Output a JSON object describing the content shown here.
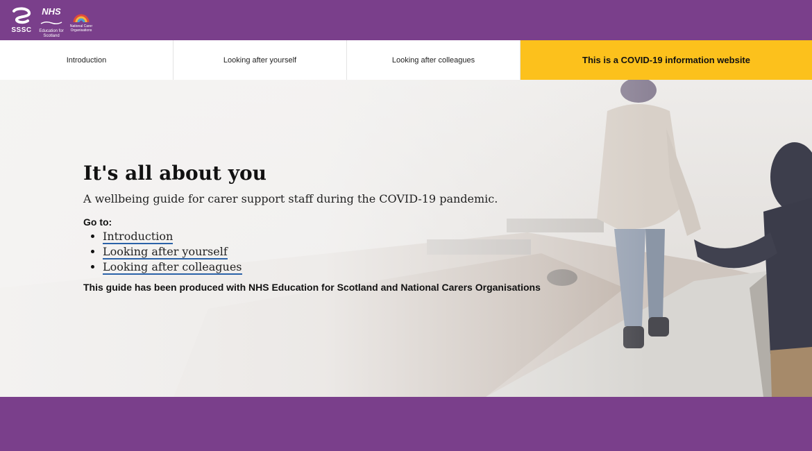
{
  "header": {
    "logos": {
      "sssc": "SSSC",
      "nhs": "NHS",
      "nhs_sub": "Education for Scotland",
      "nco_sub": "National Carer Organisations"
    }
  },
  "nav": {
    "items": [
      {
        "label": "Introduction"
      },
      {
        "label": "Looking after yourself"
      },
      {
        "label": "Looking after colleagues"
      }
    ],
    "covid_banner": "This is a COVID-19 information website"
  },
  "hero": {
    "title": "It's all about you",
    "subtitle": "A wellbeing guide for carer support staff during the COVID-19 pandemic.",
    "goto_label": "Go to:",
    "links": [
      {
        "label": "Introduction"
      },
      {
        "label": "Looking after yourself"
      },
      {
        "label": "Looking after colleagues"
      }
    ],
    "note": "This guide has been produced with NHS Education for Scotland and National Carers Organisations"
  },
  "colors": {
    "brand_purple": "#7a3f8b",
    "banner_yellow": "#fcc11c",
    "link_underline": "#2a62a8"
  }
}
